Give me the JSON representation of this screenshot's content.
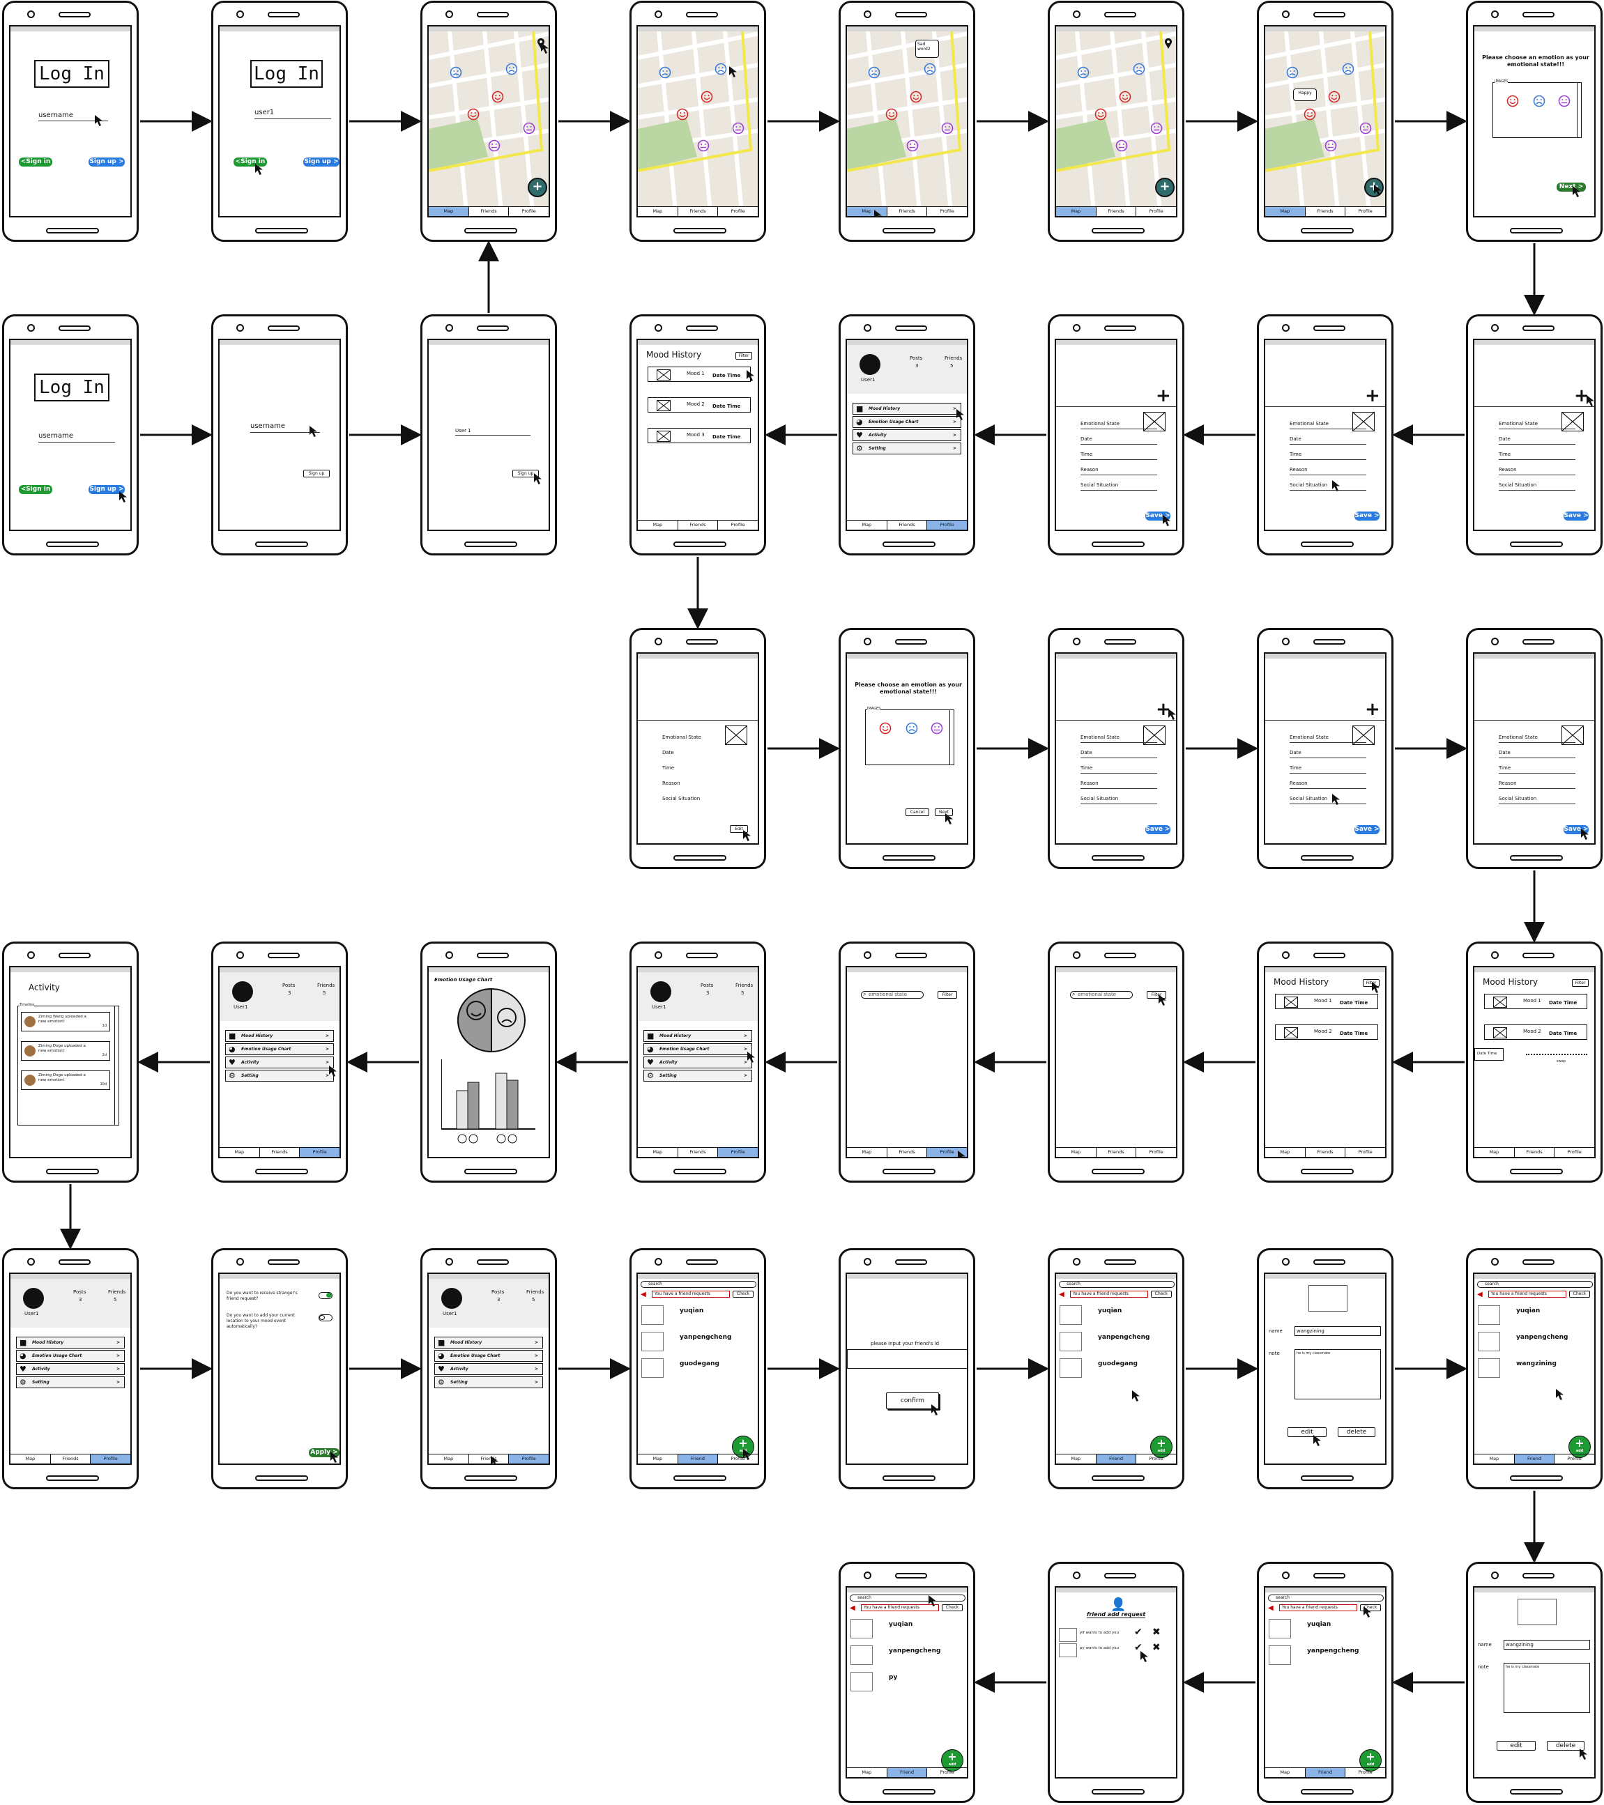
{
  "labels": {
    "log_in": "Log In",
    "username": "username",
    "user1": "user1",
    "user_1": "User 1",
    "user1_cap": "User1",
    "sign_in": "<Sign in",
    "sign_up": "Sign up >",
    "sign_up_plain": "Sign up",
    "map": "Map",
    "friends": "Friends",
    "friend": "Friend",
    "profile": "Profile",
    "sad_word": "Sad word2",
    "happy": "Happy",
    "choose_emotion": "Please choose an emotion as your emotional state!!!",
    "images": "IMAGES",
    "next": "Next >",
    "next_plain": "Next",
    "cancel": "Cancel",
    "emotional_state": "Emotional State",
    "date": "Date",
    "time": "Time",
    "reason": "Reason",
    "social_situation": "Social Situation",
    "save": "Save >",
    "edit": "Edit",
    "mood_history": "Mood History",
    "filter": "Filter",
    "mood1": "Mood 1",
    "mood2": "Mood 2",
    "mood3": "Mood 3",
    "date_time": "Date Time",
    "swap": "swap",
    "posts": "Posts",
    "posts_n": "3",
    "friends_n": "5",
    "emotion_usage_chart": "Emotion Usage Chart",
    "activity": "Activity",
    "setting": "Setting",
    "search_ph": "emotional state",
    "timeline": "Timeline",
    "act1": "Ziming Wang uploaded a new emotion!",
    "act2": "Ziming Doge uploaded a new emotion!",
    "act3": "Ziming Doge uploaded a new emotion!",
    "act_t1": "1d",
    "act_t2": "2d",
    "act_t3": "10d",
    "q_stranger": "Do you want to receive stranger's friend request?",
    "q_location": "Do you want to add your current location to your mood event automatically?",
    "apply": "Apply >",
    "search": "search",
    "friend_request": "You have a friend requests",
    "check": "Check",
    "yuqian": "yuqian",
    "yanpengcheng": "yanpengcheng",
    "guodegang": "guodegang",
    "wangzining": "wangzining",
    "py": "py",
    "add": "add",
    "input_friend_id": "please input your friend's id",
    "confirm": "confirm",
    "name": "name",
    "note": "note",
    "note_val": "he is my classmate",
    "edit_l": "edit",
    "delete": "delete",
    "friend_add_request": "friend add request",
    "yif_wants": "yif wants to add you",
    "py_wants": "py wants to add you"
  },
  "colors": {
    "face_red": "#d62828",
    "face_blue": "#3a7ad6",
    "face_purple": "#9b3fd6",
    "tab_active": "#8ab4e8",
    "green": "#1e9a32",
    "blue": "#2a7be0"
  },
  "icons": [
    "cursor-icon",
    "sad-face-icon",
    "happy-face-icon",
    "neutral-face-icon",
    "plus-icon",
    "image-placeholder-icon",
    "history-icon",
    "pie-chart-icon",
    "heart-icon",
    "gear-icon",
    "check-icon",
    "x-icon",
    "megaphone-icon",
    "add-user-icon",
    "location-pin-icon"
  ]
}
